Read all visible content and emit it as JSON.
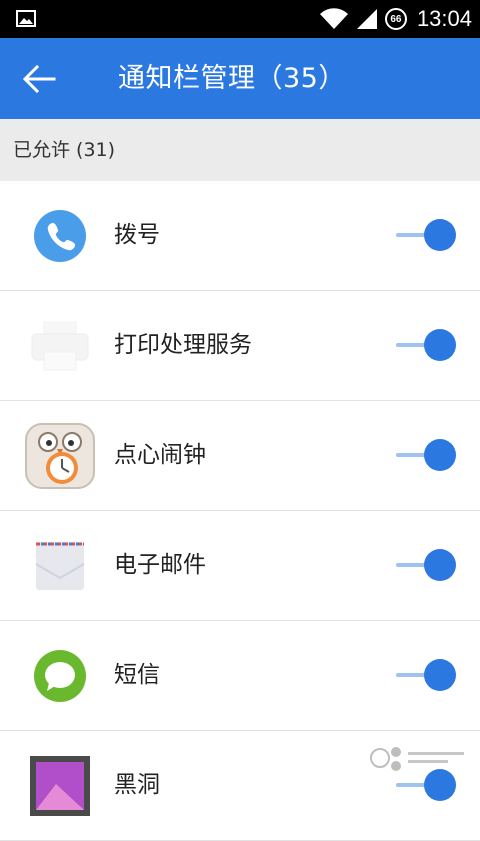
{
  "status_bar": {
    "time": "13:04",
    "battery": "66",
    "icons": [
      "image-icon",
      "wifi-icon",
      "signal-icon",
      "battery-icon"
    ]
  },
  "header": {
    "title": "通知栏管理（35）",
    "back_icon": "arrow-left-icon"
  },
  "section": {
    "label": "已允许 (31)"
  },
  "apps": [
    {
      "name": "拨号",
      "icon": "phone-icon",
      "enabled": true
    },
    {
      "name": "打印处理服务",
      "icon": "printer-icon",
      "enabled": true
    },
    {
      "name": "点心闹钟",
      "icon": "owl-alarm-clock-icon",
      "enabled": true
    },
    {
      "name": "电子邮件",
      "icon": "envelope-icon",
      "enabled": true
    },
    {
      "name": "短信",
      "icon": "message-bubble-icon",
      "enabled": true
    },
    {
      "name": "黑洞",
      "icon": "picture-frame-icon",
      "enabled": true
    }
  ],
  "colors": {
    "accent": "#2a78e0",
    "toggle_track": "#9fc2ef",
    "section_bg": "#ebebeb",
    "status_bar": "#000000"
  }
}
